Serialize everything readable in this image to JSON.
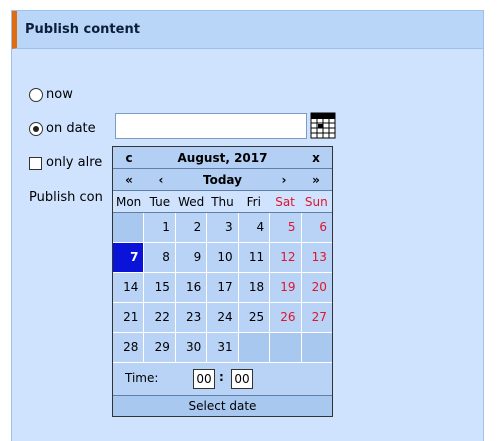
{
  "panel": {
    "title": "Publish content"
  },
  "options": {
    "now_label": "now",
    "on_date_label": "on date",
    "only_label": "only alre",
    "publish_label": "Publish con"
  },
  "date_input": {
    "value": ""
  },
  "calendar": {
    "close": "x",
    "prev_year": "«",
    "prev_month": "‹",
    "today": "Today",
    "next_month": "›",
    "next_year": "»",
    "c_btn": "c",
    "month_title": "August, 2017",
    "weekdays": [
      "Mon",
      "Tue",
      "Wed",
      "Thu",
      "Fri",
      "Sat",
      "Sun"
    ],
    "weeks": [
      [
        "",
        "1",
        "2",
        "3",
        "4",
        "5",
        "6"
      ],
      [
        "7",
        "8",
        "9",
        "10",
        "11",
        "12",
        "13"
      ],
      [
        "14",
        "15",
        "16",
        "17",
        "18",
        "19",
        "20"
      ],
      [
        "21",
        "22",
        "23",
        "24",
        "25",
        "26",
        "27"
      ],
      [
        "28",
        "29",
        "30",
        "31",
        "",
        "",
        ""
      ]
    ],
    "selected_day": "7",
    "time_label": "Time:",
    "hour": "00",
    "minute": "00",
    "time_sep": ":",
    "footer": "Select date"
  },
  "colors": {
    "accent": "#e06b10",
    "selected": "#0a14d8",
    "weekend": "#e0142c"
  }
}
